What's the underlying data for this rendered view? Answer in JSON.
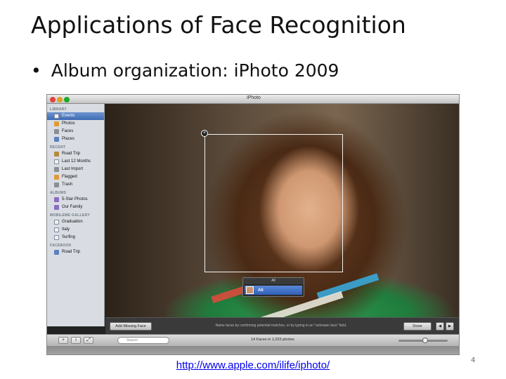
{
  "slide": {
    "title": "Applications of Face Recognition",
    "bullet_symbol": "•",
    "bullet": "Album organization: iPhoto 2009",
    "link": "http://www.apple.com/ilife/iphoto/",
    "page_number": "4"
  },
  "window": {
    "title": "iPhoto"
  },
  "sidebar": {
    "sections": [
      {
        "heading": "LIBRARY",
        "items": [
          {
            "label": "Events",
            "icon": "events-icon",
            "selected": true
          },
          {
            "label": "Photos",
            "icon": "photos-icon"
          },
          {
            "label": "Faces",
            "icon": "faces-icon"
          },
          {
            "label": "Places",
            "icon": "places-icon"
          }
        ]
      },
      {
        "heading": "RECENT",
        "items": [
          {
            "label": "Road Trip",
            "icon": "album-icon"
          },
          {
            "label": "Last 12 Months",
            "icon": "calendar-icon"
          },
          {
            "label": "Last Import",
            "icon": "import-icon"
          },
          {
            "label": "Flagged",
            "icon": "flag-icon"
          },
          {
            "label": "Trash",
            "icon": "trash-icon"
          }
        ]
      },
      {
        "heading": "ALBUMS",
        "items": [
          {
            "label": "5-Star Photos",
            "icon": "smart-album-icon"
          },
          {
            "label": "Our Family",
            "icon": "smart-album-icon"
          }
        ]
      },
      {
        "heading": "MOBILEME GALLERY",
        "items": [
          {
            "label": "Graduation",
            "icon": "gallery-icon"
          },
          {
            "label": "Italy",
            "icon": "gallery-icon"
          },
          {
            "label": "Surfing",
            "icon": "gallery-icon"
          }
        ]
      },
      {
        "heading": "FACEBOOK",
        "items": [
          {
            "label": "Road Trip",
            "icon": "facebook-album-icon"
          }
        ]
      }
    ]
  },
  "viewer": {
    "tag_header": "All",
    "tag_name": "Ali",
    "add_missing_label": "Add Missing Face",
    "hint": "Name faces by confirming potential matches, or by typing in an \"unknown face\" field.",
    "done_label": "Done"
  },
  "toolbar": {
    "add_label": "+",
    "info_label": "i",
    "fullscreen_label": "⤢",
    "search_placeholder": "Search",
    "photo_count": "14 Faces in 1,023 photos"
  },
  "colors": {
    "selection": "#3f6bb5",
    "link": "#0000ee"
  }
}
